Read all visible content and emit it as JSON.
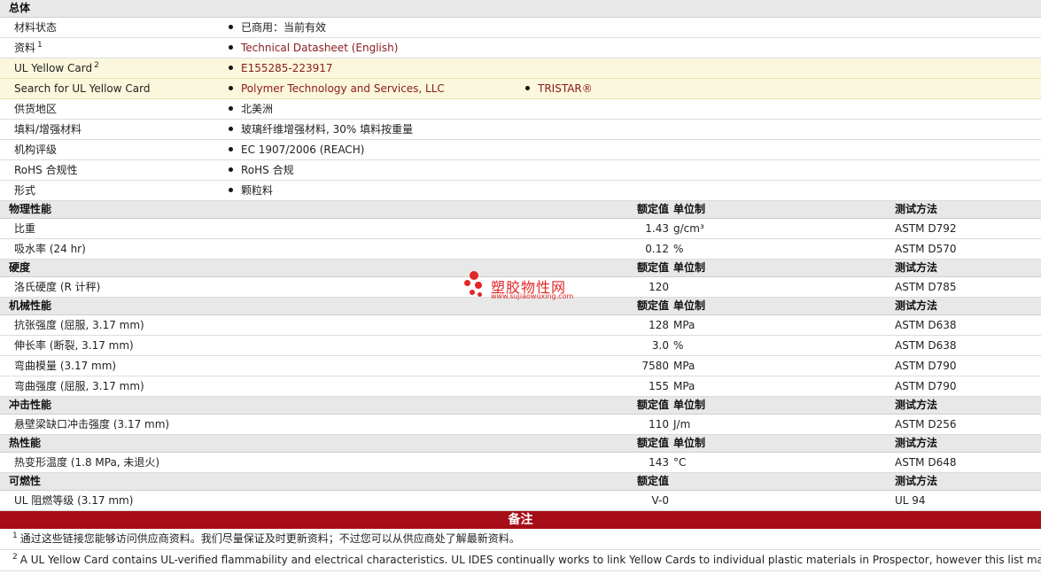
{
  "general": {
    "title": "总体",
    "rows": [
      {
        "label": "材料状态",
        "values": [
          "已商用：当前有效"
        ]
      },
      {
        "label": "资料",
        "sup": "1",
        "values": [
          "Technical Datasheet (English)"
        ],
        "link": true
      },
      {
        "label": "UL Yellow Card",
        "sup": "2",
        "values": [
          "E155285-223917"
        ],
        "link": true
      },
      {
        "label": "Search for UL Yellow Card",
        "values": [
          "Polymer Technology and Services, LLC",
          "TRISTAR®"
        ],
        "link": true
      },
      {
        "label": "供货地区",
        "values": [
          "北美洲"
        ]
      },
      {
        "label": "填料/增强材料",
        "values": [
          "玻璃纤维增强材料, 30% 填料按重量"
        ]
      },
      {
        "label": "机构评级",
        "values": [
          "EC 1907/2006 (REACH)"
        ]
      },
      {
        "label": "RoHS 合规性",
        "values": [
          "RoHS 合规"
        ]
      },
      {
        "label": "形式",
        "values": [
          "颗粒料"
        ]
      }
    ]
  },
  "headers": {
    "value": "额定值",
    "unit": "单位制",
    "method": "测试方法"
  },
  "sections": [
    {
      "title": "物理性能",
      "show_unit": true,
      "rows": [
        {
          "label": "比重",
          "value": "1.43",
          "unit": "g/cm³",
          "method": "ASTM D792"
        },
        {
          "label": "吸水率 (24 hr)",
          "value": "0.12",
          "unit": "%",
          "method": "ASTM D570"
        }
      ]
    },
    {
      "title": "硬度",
      "show_unit": true,
      "rows": [
        {
          "label": "洛氏硬度 (R 计秤)",
          "value": "120",
          "unit": "",
          "method": "ASTM D785"
        }
      ]
    },
    {
      "title": "机械性能",
      "show_unit": true,
      "rows": [
        {
          "label": "抗张强度 (屈服, 3.17 mm)",
          "value": "128",
          "unit": "MPa",
          "method": "ASTM D638"
        },
        {
          "label": "伸长率 (断裂, 3.17 mm)",
          "value": "3.0",
          "unit": "%",
          "method": "ASTM D638"
        },
        {
          "label": "弯曲模量 (3.17 mm)",
          "value": "7580",
          "unit": "MPa",
          "method": "ASTM D790"
        },
        {
          "label": "弯曲强度 (屈服, 3.17 mm)",
          "value": "155",
          "unit": "MPa",
          "method": "ASTM D790"
        }
      ]
    },
    {
      "title": "冲击性能",
      "show_unit": true,
      "rows": [
        {
          "label": "悬壁梁缺口冲击强度 (3.17 mm)",
          "value": "110",
          "unit": "J/m",
          "method": "ASTM D256"
        }
      ]
    },
    {
      "title": "热性能",
      "show_unit": true,
      "rows": [
        {
          "label": "热变形温度 (1.8 MPa, 未退火)",
          "value": "143",
          "unit": "°C",
          "method": "ASTM D648"
        }
      ]
    },
    {
      "title": "可燃性",
      "show_unit": false,
      "rows": [
        {
          "label": "UL 阻燃等级 (3.17 mm)",
          "value": "V-0",
          "unit": "",
          "method": "UL 94"
        }
      ]
    }
  ],
  "notes": {
    "title": "备注",
    "items": [
      {
        "sup": "1",
        "text": "通过这些链接您能够访问供应商资料。我们尽量保证及时更新资料；不过您可以从供应商处了解最新资料。"
      },
      {
        "sup": "2",
        "text": "A UL Yellow Card contains UL-verified flammability and electrical characteristics. UL IDES continually works to link Yellow Cards to individual plastic materials in Prospector, however this list may not i"
      }
    ]
  },
  "watermark": {
    "name": "塑胶物性网",
    "url": "www.sujiaowuxing.com"
  },
  "colors": {
    "link": "#8b1a1a",
    "notes_bar": "#a60d17",
    "highlight": "#fbf7dc",
    "section": "#e8e8e8"
  }
}
